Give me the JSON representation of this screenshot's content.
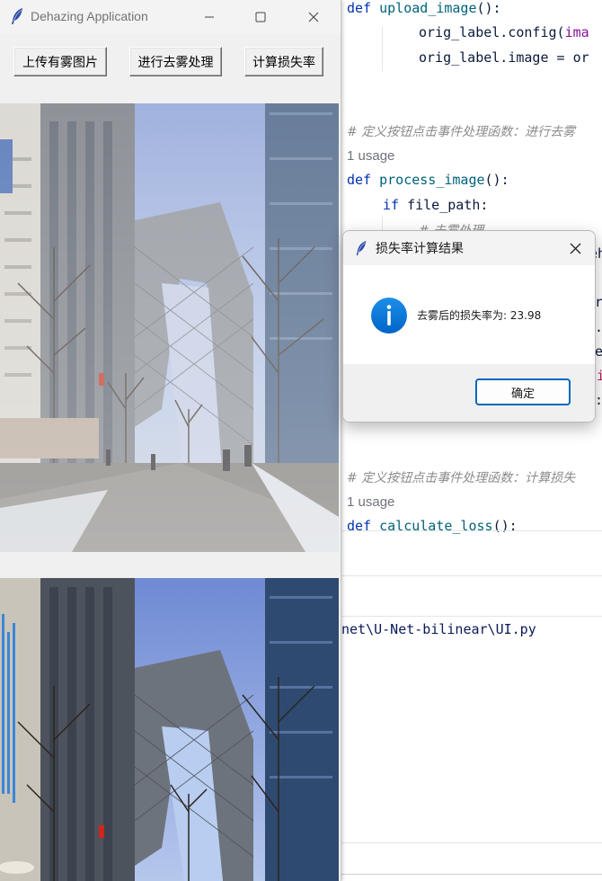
{
  "editor": {
    "lines": {
      "l1_kw": "def ",
      "l1_fn": "upload_image",
      "l1_rest": "():",
      "l2_a": "orig_label.config(",
      "l2_b": "ima",
      "l3": "orig_label.image = or",
      "comment1": "# 定义按钮点击事件处理函数：进行去雾",
      "usage1": "1 usage",
      "l4_kw": "def ",
      "l4_fn": "process_image",
      "l4_rest": "():",
      "l5_kw": "if ",
      "l5_rest": "file_path:",
      "l6": "# 去雾处理",
      "frag_a": "eh",
      "frag_b": "r",
      "frag_c": ".(",
      "frag_d": "el",
      "frag_e": "i",
      "frag_f": ":",
      "comment2": "# 定义按钮点击事件处理函数：计算损失",
      "usage2": "1 usage",
      "l7_kw": "def ",
      "l7_fn": "calculate_loss",
      "l7_rest": "():"
    },
    "terminal_path": "net\\U-Net-bilinear\\UI.py"
  },
  "app": {
    "title": "Dehazing Application",
    "buttons": {
      "upload": "上传有雾图片",
      "dehaze": "进行去雾处理",
      "loss": "计算损失率"
    }
  },
  "dialog": {
    "title": "损失率计算结果",
    "message": "去雾后的损失率为: 23.98",
    "ok": "确定"
  }
}
